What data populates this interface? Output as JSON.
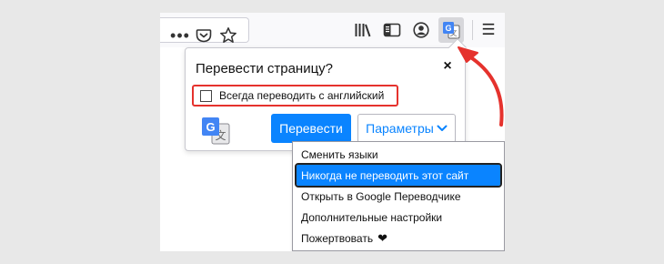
{
  "toolbar": {
    "more_glyph": "•••",
    "menu_glyph": "☰"
  },
  "panel": {
    "title": "Перевести страницу?",
    "close_glyph": "×",
    "always_label": "Всегда переводить с английский",
    "translate_label": "Перевести",
    "options_label": "Параметры"
  },
  "options_menu": {
    "items": [
      "Сменить языки",
      "Никогда не переводить этот сайт",
      "Открыть в Google Переводчике",
      "Дополнительные настройки",
      "Пожертвовать"
    ],
    "highlighted_index": 1,
    "donate_heart": "❤"
  },
  "colors": {
    "accent": "#0a84ff",
    "annotation": "#e5322d"
  },
  "icons": [
    "more-icon",
    "pocket-icon",
    "star-icon",
    "library-icon",
    "sidebar-icon",
    "account-icon",
    "translate-icon",
    "menu-icon",
    "google-translate-logo",
    "heart-icon"
  ]
}
